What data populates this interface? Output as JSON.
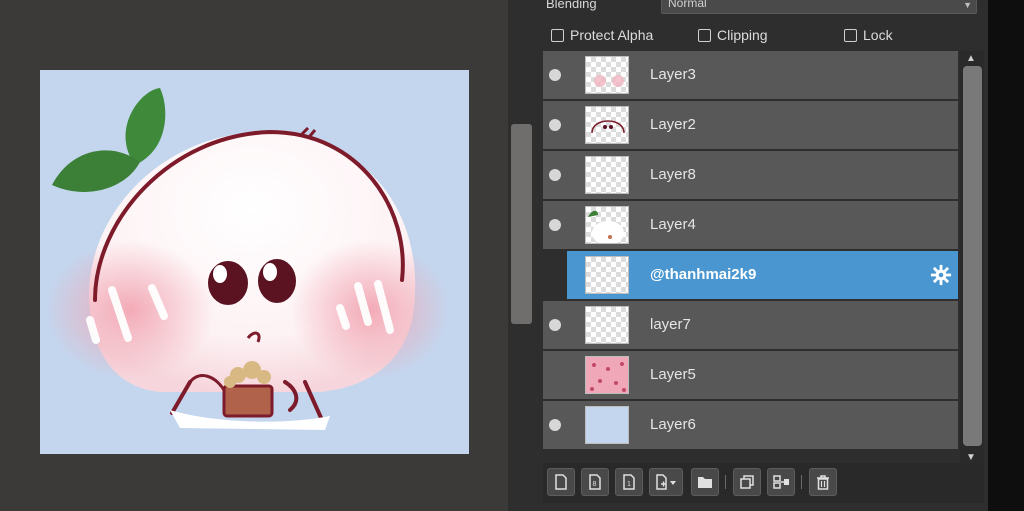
{
  "blending": {
    "label": "Blending",
    "value": "Normal"
  },
  "options": {
    "protect_alpha": "Protect Alpha",
    "clipping": "Clipping",
    "lock": "Lock"
  },
  "layers": [
    {
      "name": "Layer3",
      "visible": true,
      "selected": false
    },
    {
      "name": "Layer2",
      "visible": true,
      "selected": false
    },
    {
      "name": "Layer8",
      "visible": true,
      "selected": false
    },
    {
      "name": "Layer4",
      "visible": true,
      "selected": false
    },
    {
      "name": "@thanhmai2k9",
      "visible": false,
      "selected": true
    },
    {
      "name": "layer7",
      "visible": true,
      "selected": false
    },
    {
      "name": "Layer5",
      "visible": false,
      "selected": false
    },
    {
      "name": "Layer6",
      "visible": true,
      "selected": false
    }
  ],
  "toolbar_icons": [
    "new-layer-icon",
    "new-8bit-layer-icon",
    "new-1bit-layer-icon",
    "add-layer-menu-icon",
    "new-folder-icon",
    "duplicate-layer-icon",
    "merge-layer-icon",
    "delete-layer-icon"
  ],
  "colors": {
    "canvas_bg": "#c3d6ee",
    "selected_row": "#4996d0",
    "row_bg": "#595858",
    "panel_bg": "#2f2e2e"
  }
}
